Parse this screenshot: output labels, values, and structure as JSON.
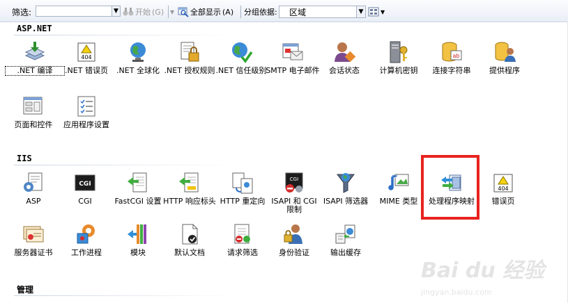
{
  "toolbar": {
    "filter_label": "筛选:",
    "filter_value": "",
    "start_label": "开始",
    "start_shortcut": "(G)",
    "show_all_label": "全部显示",
    "show_all_shortcut": "(A)",
    "group_by_label": "分组依据:",
    "group_by_value": "区域"
  },
  "groups": [
    {
      "title": "ASP.NET",
      "items": [
        {
          "label": ".NET 编译",
          "icon": "net-compile-icon"
        },
        {
          "label": ".NET 错误页",
          "icon": "net-error-pages-icon"
        },
        {
          "label": ".NET 全球化",
          "icon": "net-globalization-icon"
        },
        {
          "label": ".NET 授权规则",
          "icon": "net-authorization-icon"
        },
        {
          "label": ".NET 信任级别",
          "icon": "net-trust-levels-icon"
        },
        {
          "label": "SMTP 电子邮件",
          "icon": "smtp-email-icon"
        },
        {
          "label": "会话状态",
          "icon": "session-state-icon"
        },
        {
          "label": "计算机密钥",
          "icon": "machine-key-icon"
        },
        {
          "label": "连接字符串",
          "icon": "connection-strings-icon"
        },
        {
          "label": "提供程序",
          "icon": "providers-icon"
        },
        {
          "label": "页面和控件",
          "icon": "pages-controls-icon"
        },
        {
          "label": "应用程序设置",
          "icon": "app-settings-icon"
        }
      ]
    },
    {
      "title": "IIS",
      "items": [
        {
          "label": "ASP",
          "icon": "asp-icon"
        },
        {
          "label": "CGI",
          "icon": "cgi-icon"
        },
        {
          "label": "FastCGI 设置",
          "icon": "fastcgi-icon"
        },
        {
          "label": "HTTP 响应标头",
          "icon": "http-response-headers-icon"
        },
        {
          "label": "HTTP 重定向",
          "icon": "http-redirect-icon"
        },
        {
          "label": "ISAPI 和 CGI 限制",
          "icon": "isapi-cgi-restrictions-icon"
        },
        {
          "label": "ISAPI 筛选器",
          "icon": "isapi-filters-icon"
        },
        {
          "label": "MIME 类型",
          "icon": "mime-types-icon"
        },
        {
          "label": "处理程序映射",
          "icon": "handler-mappings-icon"
        },
        {
          "label": "错误页",
          "icon": "error-pages-icon"
        },
        {
          "label": "服务器证书",
          "icon": "server-certificates-icon"
        },
        {
          "label": "工作进程",
          "icon": "worker-processes-icon"
        },
        {
          "label": "模块",
          "icon": "modules-icon"
        },
        {
          "label": "默认文档",
          "icon": "default-document-icon"
        },
        {
          "label": "请求筛选",
          "icon": "request-filtering-icon"
        },
        {
          "label": "身份验证",
          "icon": "authentication-icon"
        },
        {
          "label": "输出缓存",
          "icon": "output-caching-icon"
        }
      ]
    },
    {
      "title": "管理",
      "items": []
    }
  ],
  "watermark": {
    "brand": "Bai du 经验",
    "site": "jingyan.baidu.com"
  },
  "colors": {
    "highlight": "#e8231f",
    "toolbar_bg": "#e9eef6"
  }
}
